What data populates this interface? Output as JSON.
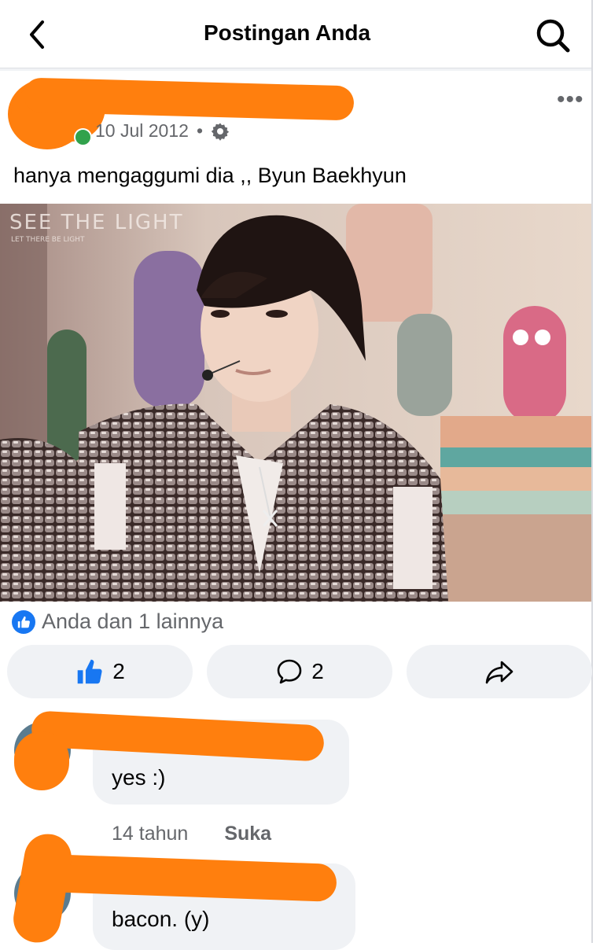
{
  "header": {
    "title": "Postingan Anda"
  },
  "post": {
    "date": "10 Jul 2012",
    "separator": "•",
    "text": "hanya mengaggumi dia ,, Byun Baekhyun",
    "more_label": "•••",
    "photo": {
      "watermark": "SEE THE LIGHT",
      "watermark_sub": "LET THERE BE LIGHT"
    }
  },
  "reactions": {
    "summary": "Anda dan 1 lainnya",
    "like_count": "2",
    "comment_count": "2"
  },
  "comments": [
    {
      "text": "yes :)"
    },
    {
      "text": "bacon. (y)"
    }
  ],
  "comment_meta": {
    "time": "14 tahun",
    "like": "Suka"
  },
  "colors": {
    "accent": "#1877f2",
    "redaction": "#ff7f0e",
    "online": "#31a24c",
    "button_bg": "#f0f2f5"
  },
  "icons": [
    "back-chevron-icon",
    "search-icon",
    "gear-icon",
    "more-icon",
    "like-icon",
    "comment-icon",
    "share-icon"
  ]
}
